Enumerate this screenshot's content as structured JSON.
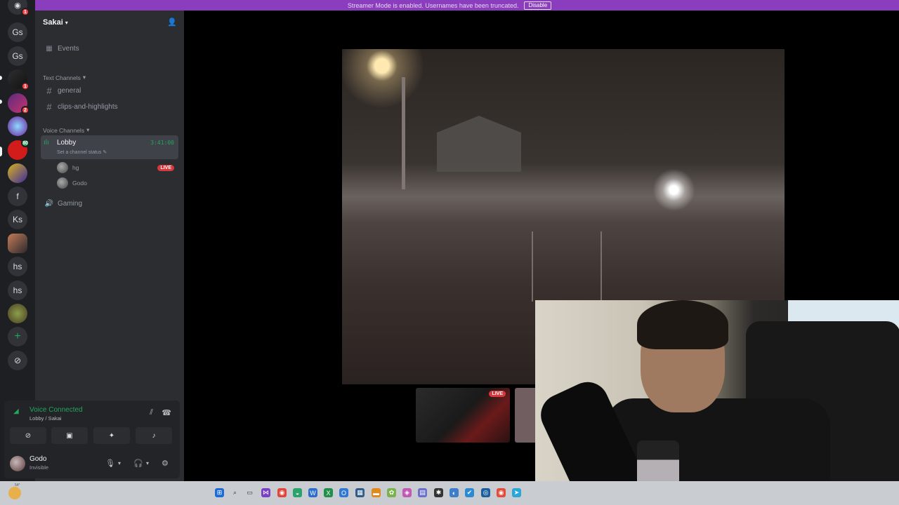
{
  "banner": {
    "text": "Streamer Mode is enabled. Usernames have been truncated.",
    "disable_label": "Disable"
  },
  "rail": {
    "home_badge": "1",
    "servers": [
      {
        "label": "Gs"
      },
      {
        "label": "Gs"
      },
      {
        "label": "",
        "badge": "1"
      },
      {
        "label": "",
        "badge": "2"
      },
      {
        "label": ""
      },
      {
        "label": "",
        "badge": "80"
      },
      {
        "label": ""
      },
      {
        "label": "f"
      },
      {
        "label": "Ks"
      },
      {
        "label": ""
      },
      {
        "label": "hs"
      },
      {
        "label": "hs"
      },
      {
        "label": ""
      }
    ],
    "add_label": "+",
    "explore_label": "⊘"
  },
  "sidebar": {
    "server_name": "Sakai",
    "events_label": "Events",
    "text_category": "Text Channels",
    "text_channels": [
      "general",
      "clips-and-highlights"
    ],
    "voice_category": "Voice Channels",
    "lobby": {
      "name": "Lobby",
      "status": "Set a channel status",
      "timer": "3:41:00"
    },
    "voice_users": [
      {
        "name": "hg",
        "live": "LIVE"
      },
      {
        "name": "Godo"
      }
    ],
    "gaming_label": "Gaming"
  },
  "rtc": {
    "title": "Voice Connected",
    "subtitle": "Lobby / Sakai"
  },
  "user": {
    "name": "Godo",
    "status": "Invisible"
  },
  "stage": {
    "thumb_live": "LIVE"
  },
  "taskbar": {
    "temp": "54°"
  },
  "colors": {
    "accent_green": "#23a55a",
    "live_red": "#da373c",
    "banner_purple": "#8a3dbd"
  }
}
